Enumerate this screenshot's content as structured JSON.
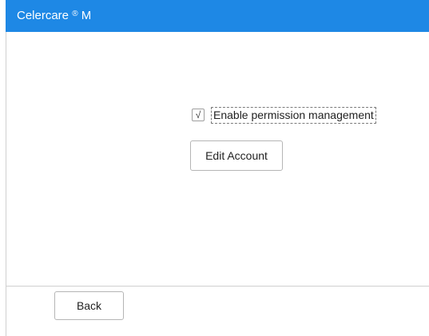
{
  "app": {
    "title": "Celercare",
    "title_mark": "®",
    "title_suffix": "M"
  },
  "permissions": {
    "checkbox_checked": true,
    "checkbox_glyph": "√",
    "checkbox_label": "Enable permission management",
    "edit_account_label": "Edit Account"
  },
  "footer": {
    "back_label": "Back"
  },
  "colors": {
    "title_bar": "#1e88e5",
    "title_text": "#ffffff",
    "background": "#ffffff",
    "button_border": "#b5b5b5"
  }
}
